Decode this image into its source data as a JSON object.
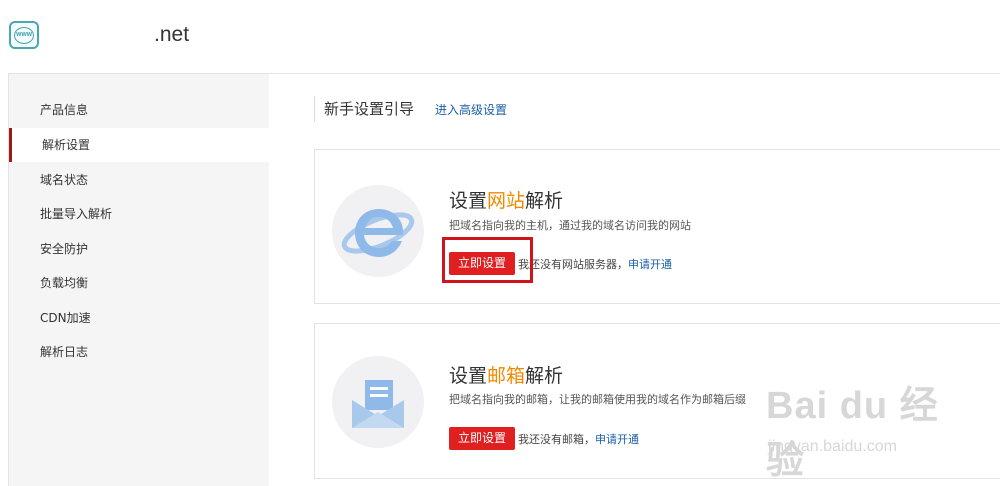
{
  "header": {
    "domain": ".net",
    "logo_icon": "www-globe-icon",
    "logo_text": "WWW"
  },
  "sidebar": {
    "active_color": "#a01818",
    "items": [
      {
        "label": "产品信息"
      },
      {
        "label": "解析设置",
        "active": true
      },
      {
        "label": "域名状态"
      },
      {
        "label": "批量导入解析"
      },
      {
        "label": "安全防护"
      },
      {
        "label": "负载均衡"
      },
      {
        "label": "CDN加速"
      },
      {
        "label": "解析日志"
      }
    ]
  },
  "main": {
    "title": "新手设置引导",
    "advanced_link": "进入高级设置",
    "cards": {
      "web": {
        "icon": "internet-explorer-icon",
        "title_prefix": "设置",
        "title_highlight": "网站",
        "title_suffix": "解析",
        "description": "把域名指向我的主机，通过我的域名访问我的网站",
        "button": "立即设置",
        "note": "我还没有网站服务器，",
        "note_link": "申请开通"
      },
      "mail": {
        "icon": "envelope-icon",
        "title_prefix": "设置",
        "title_highlight": "邮箱",
        "title_suffix": "解析",
        "description": "把域名指向我的邮箱，让我的邮箱使用我的域名作为邮箱后缀",
        "button": "立即设置",
        "note": "我还没有邮箱，",
        "note_link": "申请开通"
      }
    },
    "highlight_color": "#f08a00",
    "button_color": "#e02020",
    "link_color": "#1a5fa8"
  },
  "watermark": {
    "brand": "Bai du 经验",
    "url": "jingyan.baidu.com"
  }
}
